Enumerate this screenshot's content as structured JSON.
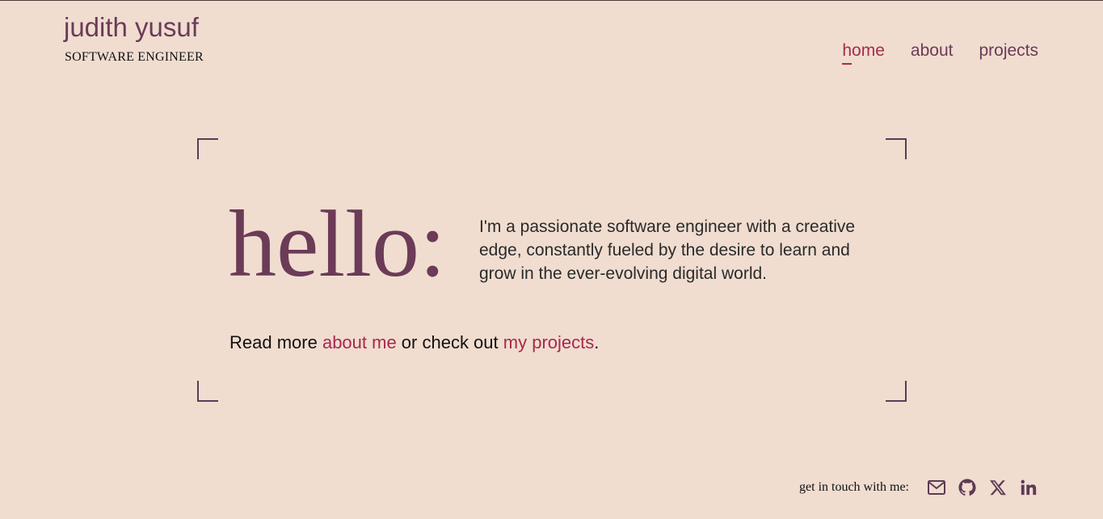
{
  "header": {
    "name": "judith yusuf",
    "subtitle": "SOFTWARE ENGINEER"
  },
  "nav": {
    "items": [
      {
        "label": "home",
        "active": true
      },
      {
        "label": "about",
        "active": false
      },
      {
        "label": "projects",
        "active": false
      }
    ]
  },
  "hero": {
    "greeting": "hello:",
    "intro": "I'm a passionate software engineer with a creative edge, constantly fueled by the desire to learn and grow in the ever-evolving digital world.",
    "readmore_prefix": "Read more ",
    "about_link": "about me",
    "readmore_middle": " or check out ",
    "projects_link": "my projects",
    "readmore_suffix": "."
  },
  "footer": {
    "contact_label": "get in touch with me:",
    "icons": [
      "mail-icon",
      "github-icon",
      "x-icon",
      "linkedin-icon"
    ]
  },
  "colors": {
    "background": "#f0ddd0",
    "primary": "#6b3b57",
    "accent": "#a8294d",
    "text": "#2a2a2a"
  }
}
